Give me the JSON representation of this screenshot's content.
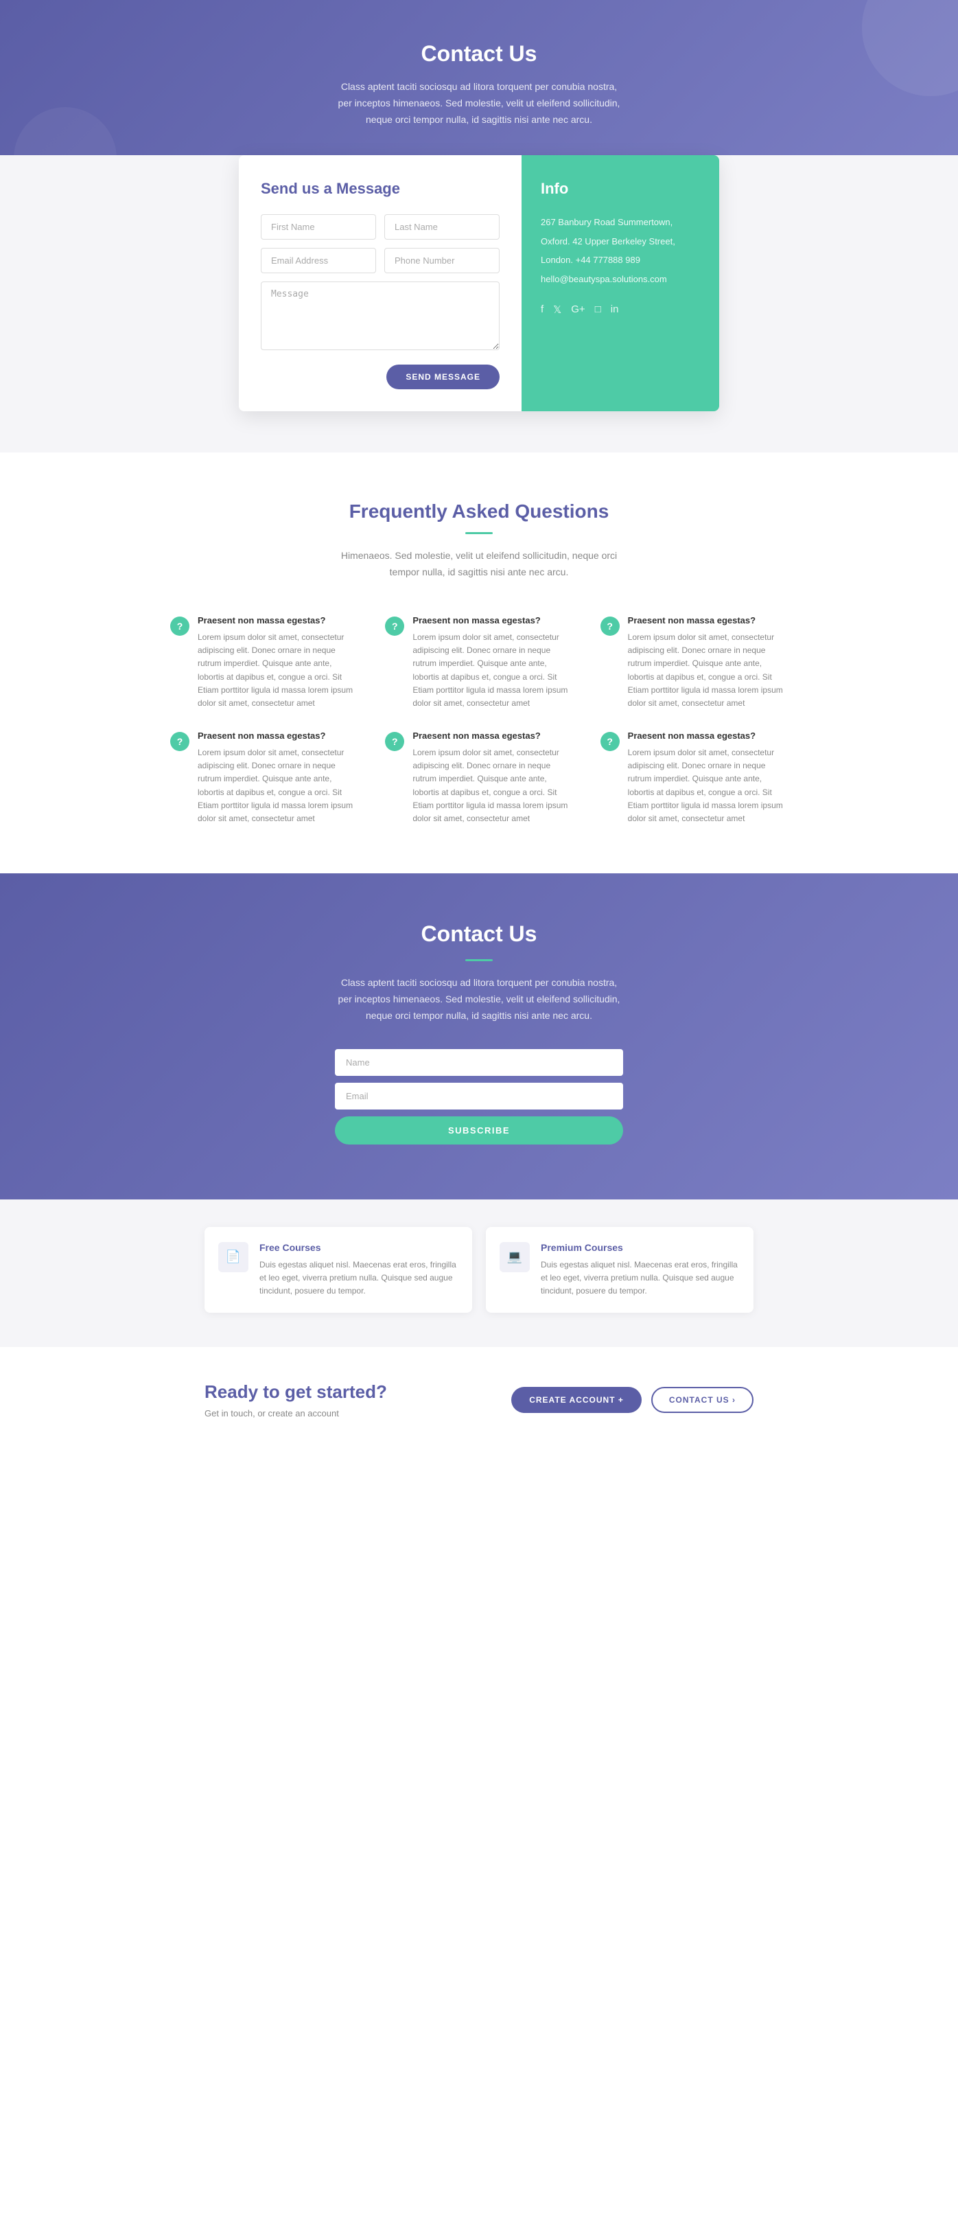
{
  "hero": {
    "title": "Contact Us",
    "description": "Class aptent taciti sociosqu ad litora torquent per conubia nostra, per inceptos himenaeos. Sed molestie, velit ut eleifend sollicitudin, neque orci tempor nulla, id sagittis nisi ante nec arcu."
  },
  "form": {
    "section_title": "Send us a Message",
    "first_name_placeholder": "First Name",
    "last_name_placeholder": "Last Name",
    "email_placeholder": "Email Address",
    "phone_placeholder": "Phone Number",
    "message_placeholder": "Message",
    "send_button": "SEND MESSAGE"
  },
  "info": {
    "title": "Info",
    "address1": "267 Banbury Road Summertown,",
    "address2": "Oxford. 42 Upper Berkeley Street,",
    "city": "London. +44 777888 989",
    "email": "hello@beautyspa.solutions.com",
    "social": {
      "facebook": "f",
      "twitter": "t",
      "googleplus": "G+",
      "instagram": "◻",
      "linkedin": "in"
    }
  },
  "faq": {
    "title": "Frequently Asked Questions",
    "underline": true,
    "description": "Himenaeos. Sed molestie, velit ut eleifend sollicitudin, neque orci tempor nulla, id sagittis nisi ante nec arcu.",
    "items": [
      {
        "title": "Praesent non massa egestas?",
        "text": "Lorem ipsum dolor sit amet, consectetur adipiscing elit. Donec ornare in neque rutrum imperdiet. Quisque ante ante, lobortis at dapibus et, congue a orci. Sit Etiam porttitor ligula id massa lorem ipsum dolor sit amet, consectetur amet"
      },
      {
        "title": "Praesent non massa egestas?",
        "text": "Lorem ipsum dolor sit amet, consectetur adipiscing elit. Donec ornare in neque rutrum imperdiet. Quisque ante ante, lobortis at dapibus et, congue a orci. Sit Etiam porttitor ligula id massa lorem ipsum dolor sit amet, consectetur amet"
      },
      {
        "title": "Praesent non massa egestas?",
        "text": "Lorem ipsum dolor sit amet, consectetur adipiscing elit. Donec ornare in neque rutrum imperdiet. Quisque ante ante, lobortis at dapibus et, congue a orci. Sit Etiam porttitor ligula id massa lorem ipsum dolor sit amet, consectetur amet"
      },
      {
        "title": "Praesent non massa egestas?",
        "text": "Lorem ipsum dolor sit amet, consectetur adipiscing elit. Donec ornare in neque rutrum imperdiet. Quisque ante ante, lobortis at dapibus et, congue a orci. Sit Etiam porttitor ligula id massa lorem ipsum dolor sit amet, consectetur amet"
      },
      {
        "title": "Praesent non massa egestas?",
        "text": "Lorem ipsum dolor sit amet, consectetur adipiscing elit. Donec ornare in neque rutrum imperdiet. Quisque ante ante, lobortis at dapibus et, congue a orci. Sit Etiam porttitor ligula id massa lorem ipsum dolor sit amet, consectetur amet"
      },
      {
        "title": "Praesent non massa egestas?",
        "text": "Lorem ipsum dolor sit amet, consectetur adipiscing elit. Donec ornare in neque rutrum imperdiet. Quisque ante ante, lobortis at dapibus et, congue a orci. Sit Etiam porttitor ligula id massa lorem ipsum dolor sit amet, consectetur amet"
      }
    ]
  },
  "newsletter": {
    "title": "Contact Us",
    "description": "Class aptent taciti sociosqu ad litora torquent per conubia nostra, per inceptos himenaeos. Sed molestie, velit ut eleifend sollicitudin, neque orci tempor nulla, id sagittis nisi ante nec arcu.",
    "name_placeholder": "Name",
    "email_placeholder": "Email",
    "subscribe_button": "SUBSCRIBE"
  },
  "courses": [
    {
      "title": "Free Courses",
      "description": "Duis egestas aliquet nisl. Maecenas erat eros, fringilla et leo eget, viverra pretium nulla. Quisque sed augue tincidunt, posuere du tempor.",
      "icon": "📄"
    },
    {
      "title": "Premium Courses",
      "description": "Duis egestas aliquet nisl. Maecenas erat eros, fringilla et leo eget, viverra pretium nulla. Quisque sed augue tincidunt, posuere du tempor.",
      "icon": "💻"
    }
  ],
  "cta": {
    "title": "Ready to get started?",
    "subtitle": "Get in touch, or create an account",
    "primary_button": "CREATE ACCOUNT +",
    "secondary_button": "CONTACT US ›"
  }
}
